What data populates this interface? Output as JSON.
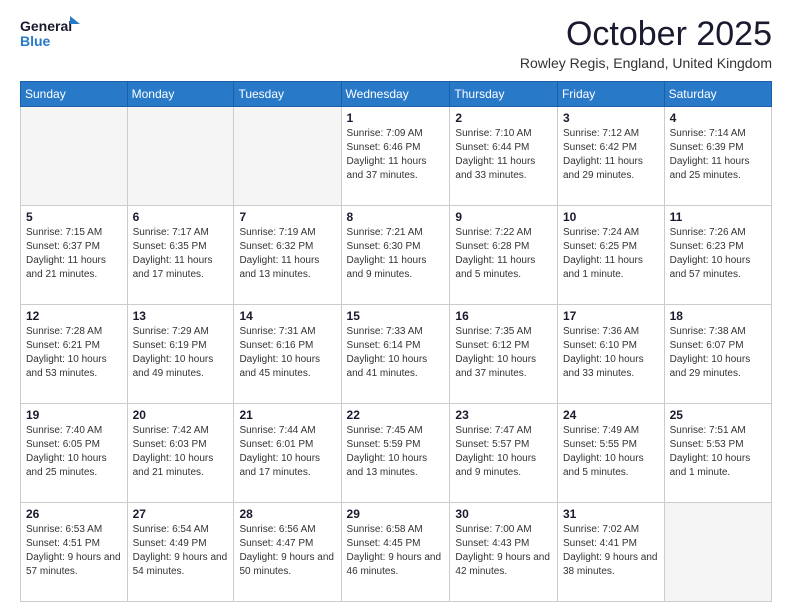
{
  "header": {
    "logo_general": "General",
    "logo_blue": "Blue",
    "month_title": "October 2025",
    "location": "Rowley Regis, England, United Kingdom"
  },
  "days_of_week": [
    "Sunday",
    "Monday",
    "Tuesday",
    "Wednesday",
    "Thursday",
    "Friday",
    "Saturday"
  ],
  "weeks": [
    [
      {
        "day": "",
        "empty": true
      },
      {
        "day": "",
        "empty": true
      },
      {
        "day": "",
        "empty": true
      },
      {
        "day": "1",
        "sunrise": "7:09 AM",
        "sunset": "6:46 PM",
        "daylight": "11 hours and 37 minutes."
      },
      {
        "day": "2",
        "sunrise": "7:10 AM",
        "sunset": "6:44 PM",
        "daylight": "11 hours and 33 minutes."
      },
      {
        "day": "3",
        "sunrise": "7:12 AM",
        "sunset": "6:42 PM",
        "daylight": "11 hours and 29 minutes."
      },
      {
        "day": "4",
        "sunrise": "7:14 AM",
        "sunset": "6:39 PM",
        "daylight": "11 hours and 25 minutes."
      }
    ],
    [
      {
        "day": "5",
        "sunrise": "7:15 AM",
        "sunset": "6:37 PM",
        "daylight": "11 hours and 21 minutes."
      },
      {
        "day": "6",
        "sunrise": "7:17 AM",
        "sunset": "6:35 PM",
        "daylight": "11 hours and 17 minutes."
      },
      {
        "day": "7",
        "sunrise": "7:19 AM",
        "sunset": "6:32 PM",
        "daylight": "11 hours and 13 minutes."
      },
      {
        "day": "8",
        "sunrise": "7:21 AM",
        "sunset": "6:30 PM",
        "daylight": "11 hours and 9 minutes."
      },
      {
        "day": "9",
        "sunrise": "7:22 AM",
        "sunset": "6:28 PM",
        "daylight": "11 hours and 5 minutes."
      },
      {
        "day": "10",
        "sunrise": "7:24 AM",
        "sunset": "6:25 PM",
        "daylight": "11 hours and 1 minute."
      },
      {
        "day": "11",
        "sunrise": "7:26 AM",
        "sunset": "6:23 PM",
        "daylight": "10 hours and 57 minutes."
      }
    ],
    [
      {
        "day": "12",
        "sunrise": "7:28 AM",
        "sunset": "6:21 PM",
        "daylight": "10 hours and 53 minutes."
      },
      {
        "day": "13",
        "sunrise": "7:29 AM",
        "sunset": "6:19 PM",
        "daylight": "10 hours and 49 minutes."
      },
      {
        "day": "14",
        "sunrise": "7:31 AM",
        "sunset": "6:16 PM",
        "daylight": "10 hours and 45 minutes."
      },
      {
        "day": "15",
        "sunrise": "7:33 AM",
        "sunset": "6:14 PM",
        "daylight": "10 hours and 41 minutes."
      },
      {
        "day": "16",
        "sunrise": "7:35 AM",
        "sunset": "6:12 PM",
        "daylight": "10 hours and 37 minutes."
      },
      {
        "day": "17",
        "sunrise": "7:36 AM",
        "sunset": "6:10 PM",
        "daylight": "10 hours and 33 minutes."
      },
      {
        "day": "18",
        "sunrise": "7:38 AM",
        "sunset": "6:07 PM",
        "daylight": "10 hours and 29 minutes."
      }
    ],
    [
      {
        "day": "19",
        "sunrise": "7:40 AM",
        "sunset": "6:05 PM",
        "daylight": "10 hours and 25 minutes."
      },
      {
        "day": "20",
        "sunrise": "7:42 AM",
        "sunset": "6:03 PM",
        "daylight": "10 hours and 21 minutes."
      },
      {
        "day": "21",
        "sunrise": "7:44 AM",
        "sunset": "6:01 PM",
        "daylight": "10 hours and 17 minutes."
      },
      {
        "day": "22",
        "sunrise": "7:45 AM",
        "sunset": "5:59 PM",
        "daylight": "10 hours and 13 minutes."
      },
      {
        "day": "23",
        "sunrise": "7:47 AM",
        "sunset": "5:57 PM",
        "daylight": "10 hours and 9 minutes."
      },
      {
        "day": "24",
        "sunrise": "7:49 AM",
        "sunset": "5:55 PM",
        "daylight": "10 hours and 5 minutes."
      },
      {
        "day": "25",
        "sunrise": "7:51 AM",
        "sunset": "5:53 PM",
        "daylight": "10 hours and 1 minute."
      }
    ],
    [
      {
        "day": "26",
        "sunrise": "6:53 AM",
        "sunset": "4:51 PM",
        "daylight": "9 hours and 57 minutes."
      },
      {
        "day": "27",
        "sunrise": "6:54 AM",
        "sunset": "4:49 PM",
        "daylight": "9 hours and 54 minutes."
      },
      {
        "day": "28",
        "sunrise": "6:56 AM",
        "sunset": "4:47 PM",
        "daylight": "9 hours and 50 minutes."
      },
      {
        "day": "29",
        "sunrise": "6:58 AM",
        "sunset": "4:45 PM",
        "daylight": "9 hours and 46 minutes."
      },
      {
        "day": "30",
        "sunrise": "7:00 AM",
        "sunset": "4:43 PM",
        "daylight": "9 hours and 42 minutes."
      },
      {
        "day": "31",
        "sunrise": "7:02 AM",
        "sunset": "4:41 PM",
        "daylight": "9 hours and 38 minutes."
      },
      {
        "day": "",
        "empty": true
      }
    ]
  ]
}
